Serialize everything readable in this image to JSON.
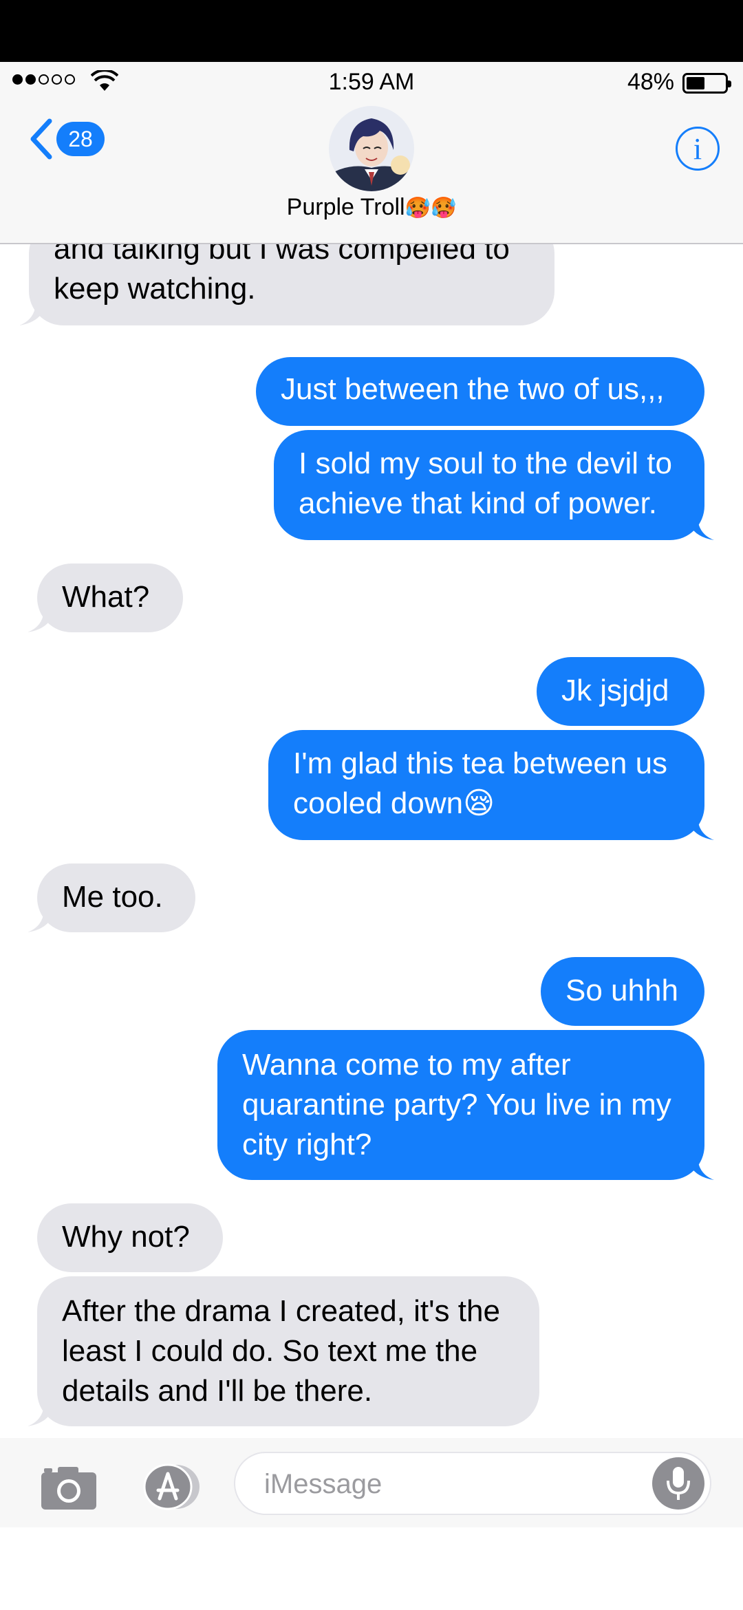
{
  "status_bar": {
    "time": "1:59 AM",
    "battery_percent": "48%",
    "battery_level": 0.48,
    "signal_bars_filled": 2,
    "signal_bars_total": 5
  },
  "nav": {
    "back_count": "28",
    "contact_name": "Purple Troll",
    "contact_emoji": "🥵🥵",
    "info_icon": "info-icon"
  },
  "messages": [
    {
      "direction": "received",
      "text": "and talking but I was compelled to keep watching."
    },
    {
      "direction": "sent",
      "text": "Just between the two of us,,,"
    },
    {
      "direction": "sent",
      "text": "I sold my soul to the devil to achieve that kind of power."
    },
    {
      "direction": "received",
      "text": "What?"
    },
    {
      "direction": "sent",
      "text": "Jk jsjdjd"
    },
    {
      "direction": "sent",
      "text": "I'm glad this tea between us cooled down😪"
    },
    {
      "direction": "received",
      "text": "Me too."
    },
    {
      "direction": "sent",
      "text": "So uhhh"
    },
    {
      "direction": "sent",
      "text": "Wanna come to my after quarantine party? You live in my city right?"
    },
    {
      "direction": "received",
      "text": "Why not?"
    },
    {
      "direction": "received",
      "text": "After the drama I created, it's the least I could do. So text me the details and I'll be there."
    }
  ],
  "input_bar": {
    "placeholder": "iMessage",
    "value": ""
  },
  "colors": {
    "sent_bubble": "#147efb",
    "received_bubble": "#e5e5ea",
    "accent": "#147efb"
  }
}
